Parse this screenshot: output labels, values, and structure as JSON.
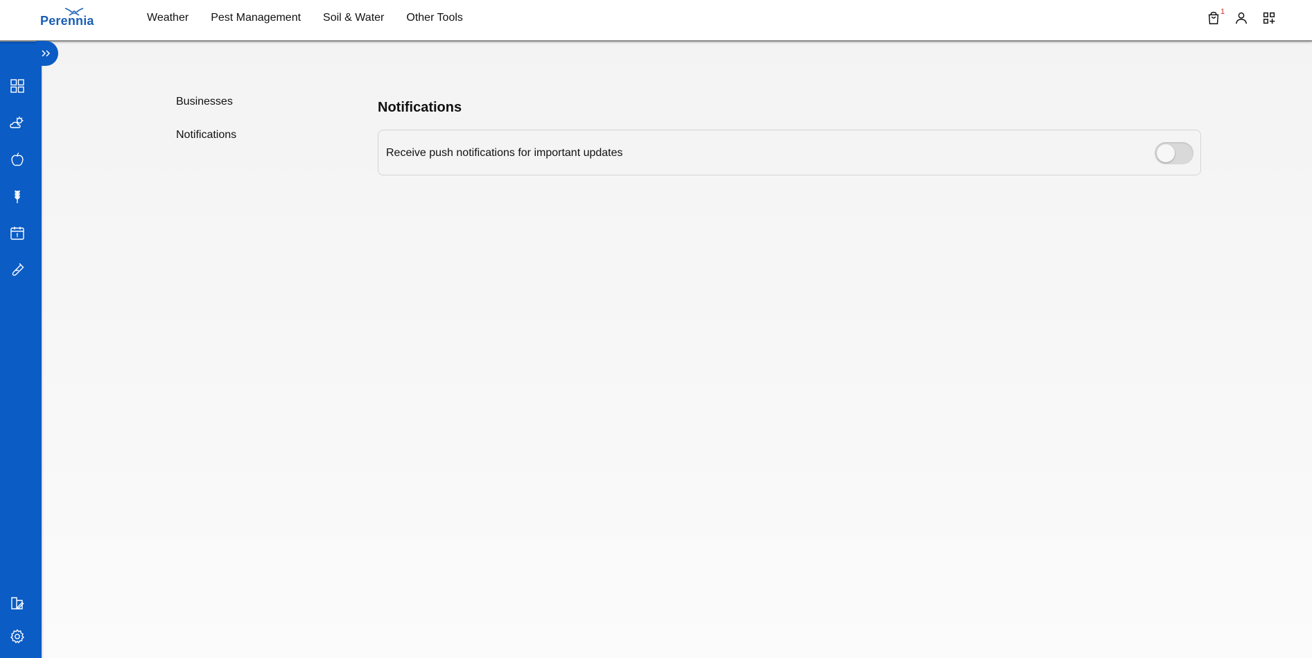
{
  "brand": {
    "logo_text": "Perennia",
    "accent": "#0b5cc4"
  },
  "top_nav": {
    "items": [
      {
        "label": "Weather"
      },
      {
        "label": "Pest Management"
      },
      {
        "label": "Soil & Water"
      },
      {
        "label": "Other Tools"
      }
    ]
  },
  "header_icons": {
    "cart": {
      "icon": "shopping-bag-icon",
      "badge": "1",
      "badge_color": "#d9281e"
    },
    "account": {
      "icon": "user-icon"
    },
    "apps": {
      "icon": "apps-grid-icon"
    }
  },
  "sidebar": {
    "toggle_icon": "double-chevron-right-icon",
    "items": [
      {
        "icon": "dashboard-grid-icon"
      },
      {
        "icon": "weather-cloud-sun-icon"
      },
      {
        "icon": "apple-icon"
      },
      {
        "icon": "wheat-icon"
      },
      {
        "icon": "calendar-icon"
      },
      {
        "icon": "test-tube-icon"
      }
    ],
    "bottom_items": [
      {
        "icon": "document-edit-icon"
      },
      {
        "icon": "settings-gear-icon"
      }
    ]
  },
  "settings_nav": {
    "items": [
      {
        "label": "Businesses"
      },
      {
        "label": "Notifications"
      }
    ]
  },
  "notifications": {
    "title": "Notifications",
    "push_setting": {
      "label": "Receive push notifications for important updates",
      "enabled": false
    }
  }
}
